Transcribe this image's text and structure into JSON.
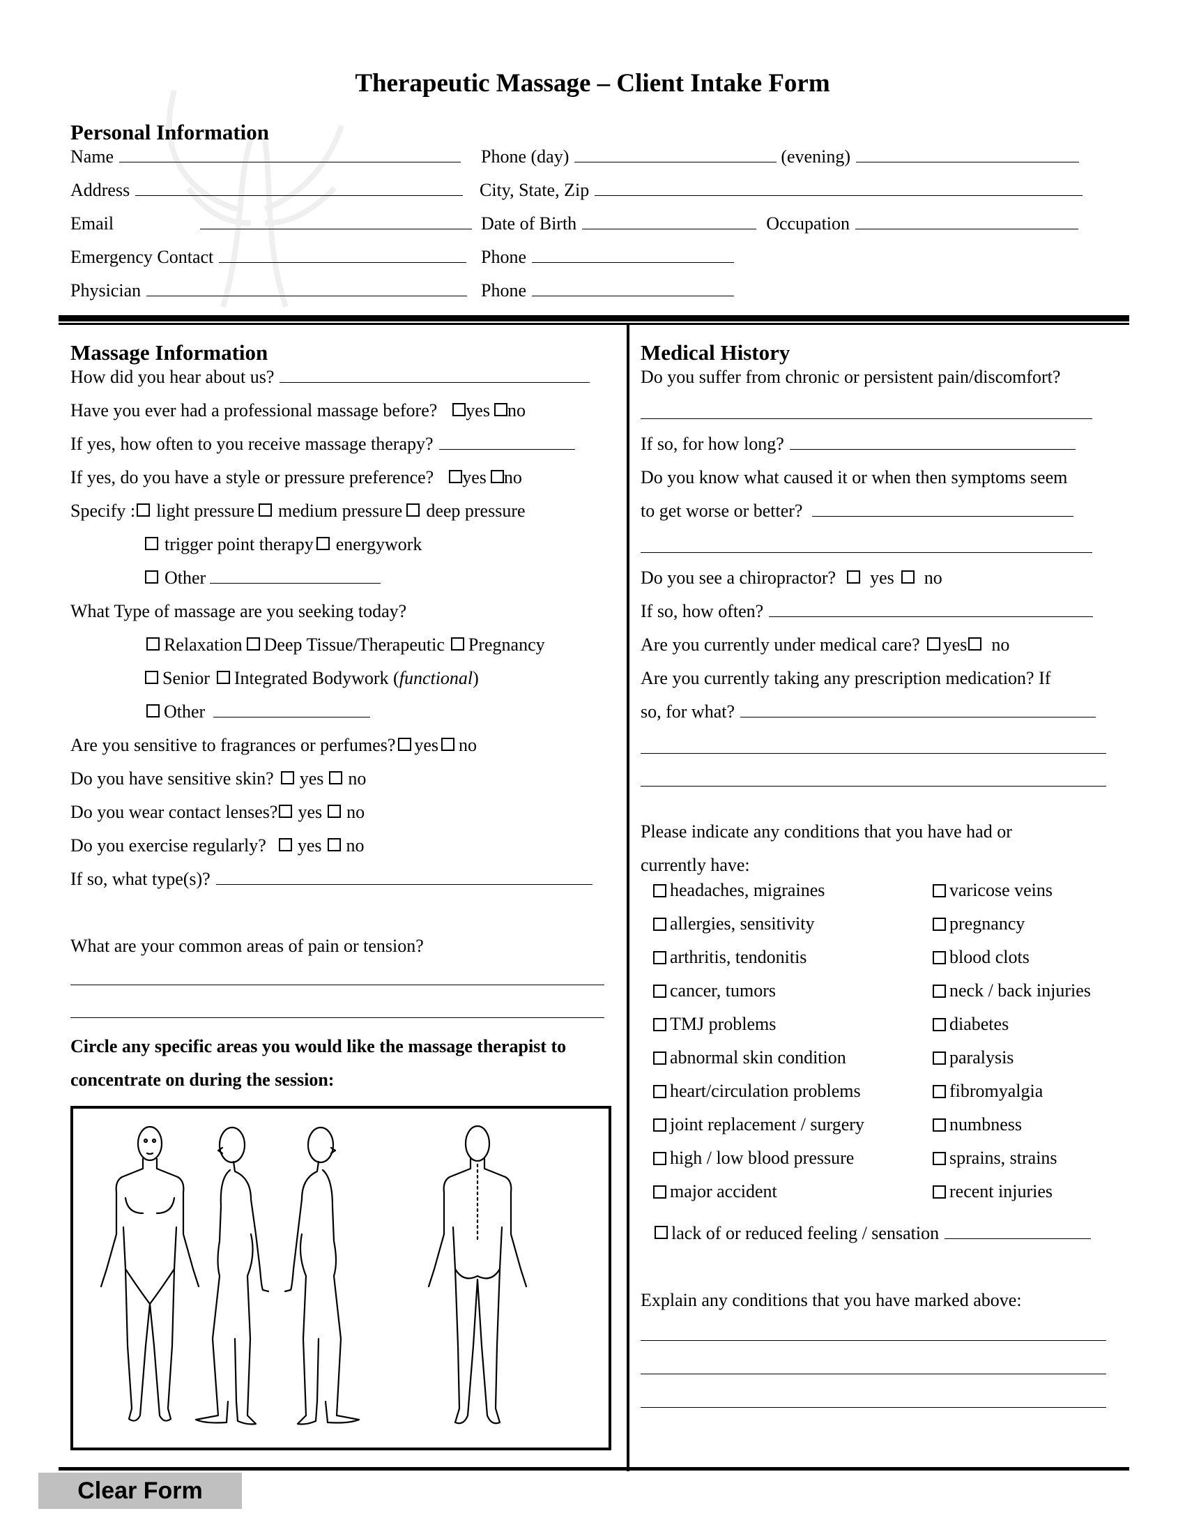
{
  "title": "Therapeutic Massage – Client Intake Form",
  "personal": {
    "heading": "Personal Information",
    "name": "Name",
    "phone_day": "Phone (day)",
    "evening": "(evening)",
    "address": "Address",
    "city_state_zip": "City, State, Zip",
    "email": "Email",
    "dob": "Date of Birth",
    "occupation": "Occupation",
    "emergency_contact": "Emergency Contact",
    "phone": "Phone",
    "physician": "Physician"
  },
  "massage": {
    "heading": "Massage Information",
    "hear_about": "How did you hear about us?",
    "had_before": "Have you ever had a professional massage before?",
    "how_often": "If yes, how often to you receive massage therapy?",
    "preference": "If yes, do you have a style or pressure preference?",
    "specify": "Specify :",
    "pressure_options": [
      "light pressure",
      "medium pressure",
      "deep pressure",
      "trigger point therapy",
      "energywork",
      "Other"
    ],
    "type_question": "What Type of massage are you seeking today?",
    "type_options": [
      "Relaxation",
      "Deep Tissue/Therapeutic",
      "Pregnancy",
      "Senior",
      "Integrated Bodywork (",
      "functional",
      ")",
      "Other"
    ],
    "fragrances": "Are you sensitive to fragrances or perfumes?",
    "skin": "Do you have sensitive skin?",
    "lenses": "Do you wear contact lenses?",
    "exercise": "Do you exercise regularly?",
    "exercise_type": "If so, what type(s)?",
    "pain_areas": "What are your common areas of pain or tension?",
    "circle_instruction_1": "Circle any specific areas you would like the massage therapist to",
    "circle_instruction_2": "concentrate on during the session:",
    "yes": "yes",
    "no": "no"
  },
  "medical": {
    "heading": "Medical History",
    "chronic_pain": "Do you suffer from chronic or persistent pain/discomfort?",
    "how_long": "If so, for how long?",
    "cause_1": "Do you know what caused it or when then symptoms seem",
    "cause_2": "to get worse or better?",
    "chiropractor": "Do you see a chiropractor?",
    "how_often": "If so, how often?",
    "medical_care": "Are you currently under medical care?",
    "medication_1": "Are you currently taking any prescription medication?  If",
    "medication_2": "so, for what?",
    "conditions_intro_1": "Please indicate any conditions that you have had or",
    "conditions_intro_2": "currently have:",
    "conditions_left": [
      "headaches, migraines",
      "allergies, sensitivity",
      "arthritis, tendonitis",
      "cancer, tumors",
      "TMJ problems",
      "abnormal skin condition",
      "heart/circulation problems",
      "joint replacement / surgery",
      "high / low blood pressure",
      "major accident"
    ],
    "conditions_right": [
      "varicose veins",
      "pregnancy",
      "blood clots",
      "neck / back injuries",
      "diabetes",
      "paralysis",
      "fibromyalgia",
      "numbness",
      "sprains, strains",
      "recent injuries"
    ],
    "reduced_feeling": "lack of or reduced feeling / sensation",
    "explain": "Explain any conditions that you have marked above:",
    "yes": "yes",
    "no": "no"
  },
  "buttons": {
    "clear_form": "Clear Form"
  }
}
